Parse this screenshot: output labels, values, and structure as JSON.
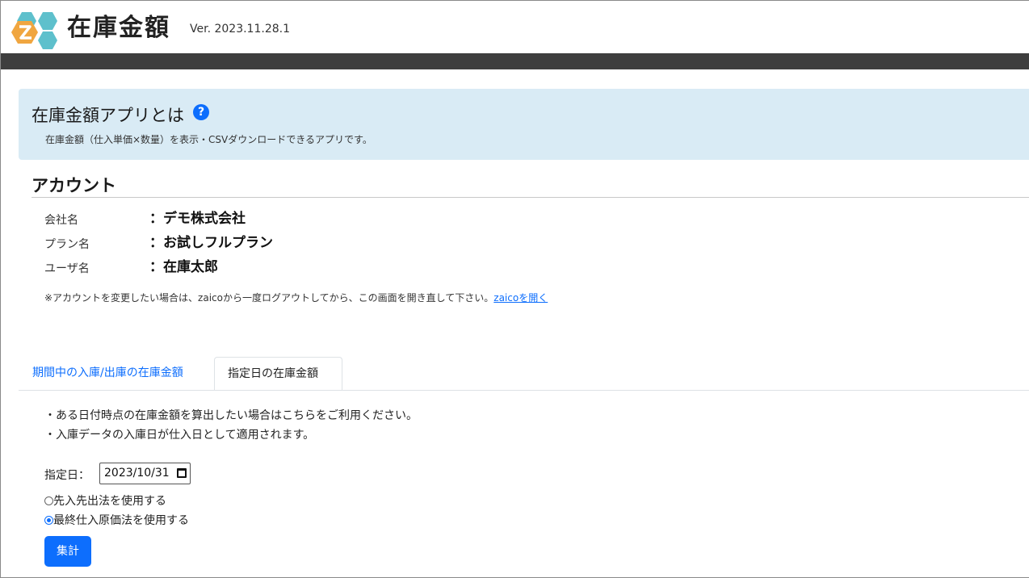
{
  "header": {
    "app_title": "在庫金額",
    "version": "Ver. 2023.11.28.1"
  },
  "info": {
    "title": "在庫金額アプリとは",
    "help_icon": "?",
    "description": "在庫金額（仕入単価×数量）を表示・CSVダウンロードできるアプリです。"
  },
  "account": {
    "title": "アカウント",
    "rows": [
      {
        "label": "会社名",
        "value": "：デモ株式会社"
      },
      {
        "label": "プラン名",
        "value": "：お試しフルプラン"
      },
      {
        "label": "ユーザ名",
        "value": "：在庫太郎"
      }
    ],
    "note": "※アカウントを変更したい場合は、zaicoから一度ログアウトしてから、この画面を開き直して下さい。",
    "link": "zaicoを開く"
  },
  "tabs": [
    {
      "label": "期間中の入庫/出庫の在庫金額",
      "active": false
    },
    {
      "label": "指定日の在庫金額",
      "active": true
    }
  ],
  "panel": {
    "bullets": [
      "・ある日付時点の在庫金額を算出したい場合はこちらをご利用ください。",
      "・入庫データの入庫日が仕入日として適用されます。"
    ],
    "date_label": "指定日：",
    "date_value": "2023/10/31",
    "options": [
      {
        "label": "先入先出法を使用する",
        "checked": false
      },
      {
        "label": "最終仕入原価法を使用する",
        "checked": true
      }
    ],
    "submit_label": "集計"
  },
  "colors": {
    "accent": "#0d6efd",
    "info_bg": "#d9ebf5",
    "dark_bar": "#3e3e3e",
    "logo_orange": "#f0a640",
    "logo_teal": "#5ec0cc"
  }
}
